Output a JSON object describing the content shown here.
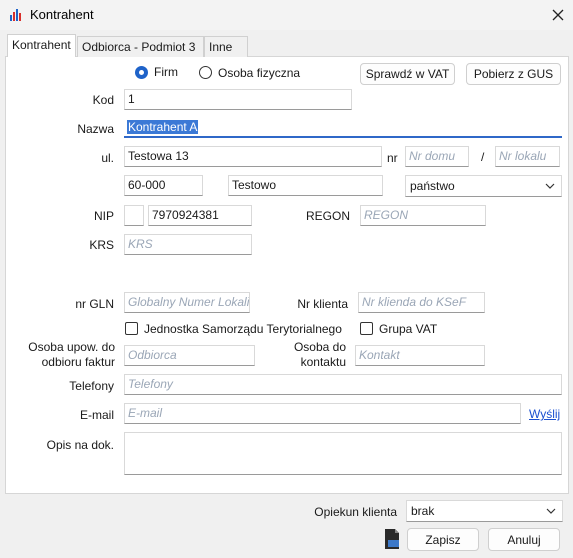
{
  "window": {
    "title": "Kontrahent"
  },
  "tabs": [
    "Kontrahent",
    "Odbiorca - Podmiot 3",
    "Inne"
  ],
  "type_options": {
    "firm": "Firm",
    "person": "Osoba fizyczna"
  },
  "buttons": {
    "check_vat": "Sprawdź w VAT",
    "fetch_gus": "Pobierz z GUS",
    "save": "Zapisz",
    "cancel": "Anuluj",
    "send": "Wyślij"
  },
  "labels": {
    "kod": "Kod",
    "nazwa": "Nazwa",
    "ul": "ul.",
    "nr": "nr",
    "slash": "/",
    "nip": "NIP",
    "regon": "REGON",
    "krs": "KRS",
    "nr_gln": "nr GLN",
    "nr_klienta": "Nr klienta",
    "jst": "Jednostka Samorządu Terytorialnego",
    "grupa_vat": "Grupa VAT",
    "osoba_upow_1": "Osoba upow. do",
    "osoba_upow_2": "odbioru faktur",
    "osoba_kontakt_1": "Osoba do",
    "osoba_kontakt_2": "kontaktu",
    "telefony": "Telefony",
    "email": "E-mail",
    "opis": "Opis na dok.",
    "opiekun": "Opiekun klienta"
  },
  "values": {
    "kod": "1",
    "nazwa": "Kontrahent A",
    "ulica": "Testowa 13",
    "kod_pocztowy": "60-000",
    "miasto": "Testowo",
    "kraj": "państwo",
    "nip_prefix": "",
    "nip": "7970924381",
    "opiekun": "brak"
  },
  "placeholders": {
    "nr_domu": "Nr domu",
    "nr_lokalu": "Nr lokalu",
    "regon": "REGON",
    "krs": "KRS",
    "gln": "Globalny Numer Lokali",
    "nr_klienta": "Nr klienda do KSeF",
    "osoba_upow": "Odbiorca",
    "osoba_kontakt": "Kontakt",
    "telefony": "Telefony",
    "email": "E-mail"
  },
  "colors": {
    "accent": "#1f63c9",
    "link": "#1a4fd0",
    "placeholder": "#9aa6b6"
  }
}
